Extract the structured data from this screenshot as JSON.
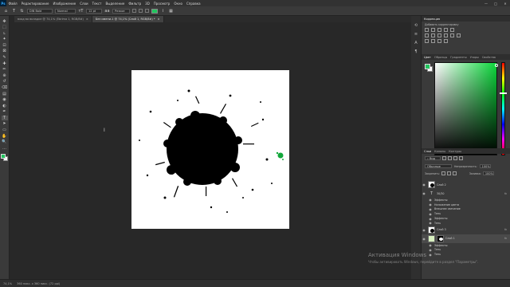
{
  "app": {
    "logo": "Ps"
  },
  "menu": [
    "Файл",
    "Редактирование",
    "Изображение",
    "Слои",
    "Текст",
    "Выделение",
    "Фильтр",
    "3D",
    "Просмотр",
    "Окно",
    "Справка"
  ],
  "window_controls": [
    "—",
    "□",
    "✕"
  ],
  "options": {
    "font_family": "DIN Bold",
    "font_style": "Normal",
    "font_size": "12 pt",
    "antialias": "Резкое",
    "color": "#22c55e"
  },
  "tabs": [
    {
      "label": "вход во вкладке @ 74,1% (Ebrima 1, RGB/8#)",
      "active": false
    },
    {
      "label": "Без имени-1 @ 74,1% (Слой 1, RGB/8#) *",
      "active": true
    }
  ],
  "tools": [
    "move-tool-icon",
    "marquee-tool-icon",
    "lasso-tool-icon",
    "magic-wand-icon",
    "crop-tool-icon",
    "frame-tool-icon",
    "eyedropper-icon",
    "healing-brush-icon",
    "brush-tool-icon",
    "clone-stamp-icon",
    "history-brush-icon",
    "eraser-icon",
    "gradient-tool-icon",
    "blur-tool-icon",
    "dodge-tool-icon",
    "pen-tool-icon",
    "type-tool-icon",
    "path-select-icon",
    "shape-tool-icon",
    "hand-tool-icon",
    "zoom-tool-icon",
    "more-tools-icon"
  ],
  "tool_glyphs": [
    "✥",
    "⬚",
    "ʟ",
    "✦",
    "⊡",
    "⊠",
    "✎",
    "✚",
    "✏",
    "⊕",
    "↺",
    "⌫",
    "▤",
    "◉",
    "◐",
    "✒",
    "T",
    "➤",
    "▭",
    "✋",
    "🔍",
    "…"
  ],
  "panels": {
    "adjustments": {
      "title": "Коррекция",
      "subtitle": "Добавить корректировку"
    },
    "color_tabs": [
      "Цвет",
      "Образцы",
      "Градиенты",
      "Узоры",
      "Свойства"
    ],
    "layer_tabs": [
      "Слои",
      "Каналы",
      "Контуры"
    ],
    "filter_label": "Вид",
    "blend_mode": "Обычные",
    "opacity_label": "Непрозрачность:",
    "opacity": "100%",
    "lock_label": "Закрепить:",
    "fill_label": "Заливка:",
    "fill": "100%"
  },
  "color": {
    "foreground": "#22c55e",
    "background": "#ffffff",
    "hue_base": "#0bd63a"
  },
  "layers": [
    {
      "name": "Слой 2",
      "fx": false,
      "thumb": "blot"
    },
    {
      "name": "30/30",
      "fx": true,
      "thumb": "text"
    },
    {
      "name": "Эффекты",
      "sub": true
    },
    {
      "name": "Наложение цвета",
      "sub": true
    },
    {
      "name": "Внешнее свечение",
      "sub": true
    },
    {
      "name": "Тень",
      "sub": true
    },
    {
      "name": "Эффекты",
      "sub": true
    },
    {
      "name": "Тень",
      "sub": true
    },
    {
      "name": "Слой 3",
      "fx": true,
      "thumb": "blot"
    },
    {
      "name": "Слой 1",
      "fx": true,
      "thumb": "layer",
      "selected": true
    },
    {
      "name": "Эффекты",
      "sub": true
    },
    {
      "name": "Тень",
      "sub": true
    },
    {
      "name": "Тень",
      "sub": true
    }
  ],
  "status": {
    "zoom": "74,1%",
    "doc_size": "360 пикс. x 360 пикс. (72 ppi)"
  },
  "watermark": {
    "title": "Активация Windows",
    "text": "Чтобы активировать Windows, перейдите в раздел \"Параметры\"."
  }
}
